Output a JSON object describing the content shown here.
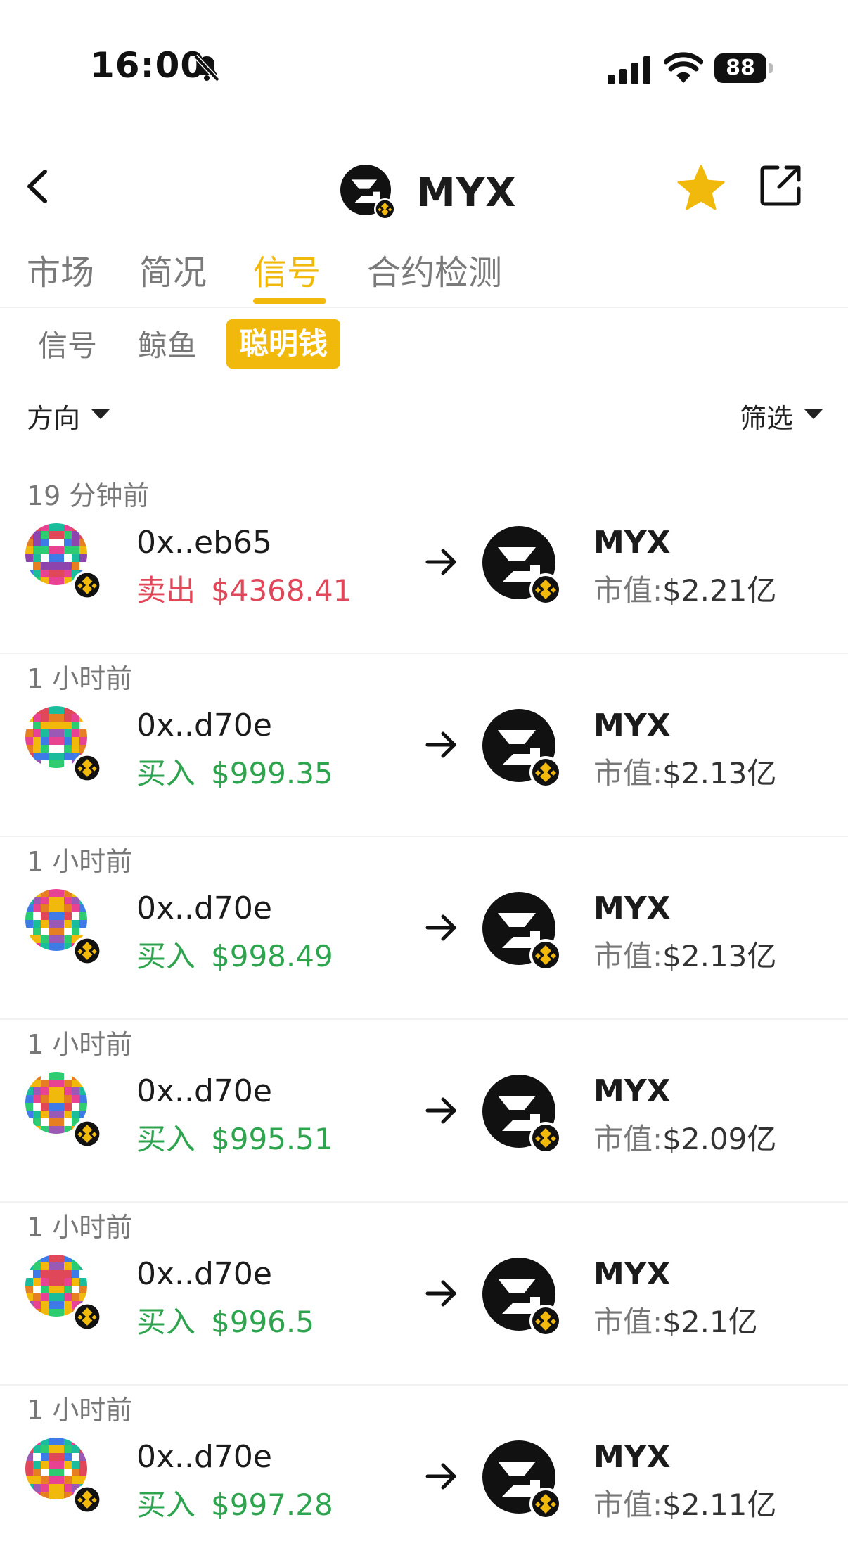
{
  "status_bar": {
    "time": "16:00",
    "battery": "88"
  },
  "header": {
    "title": "MYX"
  },
  "tabs": [
    {
      "label": "市场"
    },
    {
      "label": "简况"
    },
    {
      "label": "信号"
    },
    {
      "label": "合约检测"
    }
  ],
  "active_tab": "信号",
  "subtabs": [
    {
      "label": "信号"
    },
    {
      "label": "鲸鱼"
    },
    {
      "label": "聪明钱"
    }
  ],
  "active_subtab": "聪明钱",
  "filters": {
    "direction": "方向",
    "filter": "筛选"
  },
  "colors": {
    "accent": "#f0b90b",
    "sell": "#e0485a",
    "buy": "#2ea44f"
  },
  "items": [
    {
      "time": "19 分钟前",
      "address": "0x..eb65",
      "action": "卖出",
      "amount": "$4368.41",
      "side": "sell",
      "symbol": "MYX",
      "mcap_label": "市值:",
      "mcap": "$2.21亿"
    },
    {
      "time": "1 小时前",
      "address": "0x..d70e",
      "action": "买入",
      "amount": "$999.35",
      "side": "buy",
      "symbol": "MYX",
      "mcap_label": "市值:",
      "mcap": "$2.13亿"
    },
    {
      "time": "1 小时前",
      "address": "0x..d70e",
      "action": "买入",
      "amount": "$998.49",
      "side": "buy",
      "symbol": "MYX",
      "mcap_label": "市值:",
      "mcap": "$2.13亿"
    },
    {
      "time": "1 小时前",
      "address": "0x..d70e",
      "action": "买入",
      "amount": "$995.51",
      "side": "buy",
      "symbol": "MYX",
      "mcap_label": "市值:",
      "mcap": "$2.09亿"
    },
    {
      "time": "1 小时前",
      "address": "0x..d70e",
      "action": "买入",
      "amount": "$996.5",
      "side": "buy",
      "symbol": "MYX",
      "mcap_label": "市值:",
      "mcap": "$2.1亿"
    },
    {
      "time": "1 小时前",
      "address": "0x..d70e",
      "action": "买入",
      "amount": "$997.28",
      "side": "buy",
      "symbol": "MYX",
      "mcap_label": "市值:",
      "mcap": "$2.11亿"
    }
  ]
}
